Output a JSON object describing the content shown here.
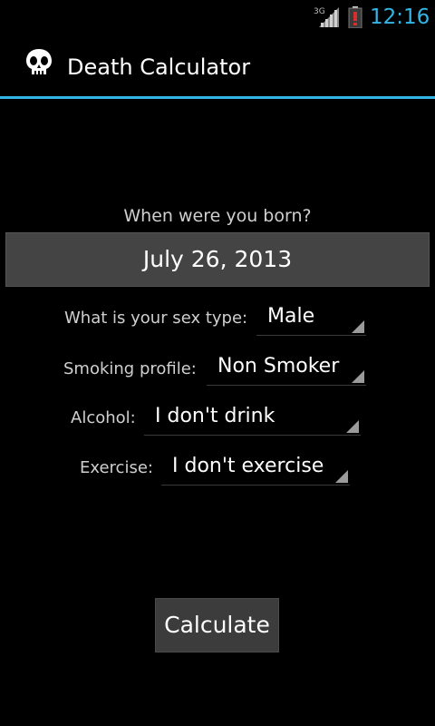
{
  "status_bar": {
    "network": "3G",
    "time": "12:16"
  },
  "action_bar": {
    "title": "Death Calculator",
    "icon": "skull-icon"
  },
  "form": {
    "birth_question": "When were you born?",
    "birth_date": "July 26, 2013",
    "sex": {
      "label": "What is your sex type:",
      "value": "Male"
    },
    "smoking": {
      "label": "Smoking profile:",
      "value": "Non Smoker"
    },
    "alcohol": {
      "label": "Alcohol:",
      "value": "I don't drink"
    },
    "exercise": {
      "label": "Exercise:",
      "value": "I don't exercise"
    },
    "calculate_label": "Calculate"
  },
  "colors": {
    "accent": "#33b5e5",
    "battery_alert": "#d32f2f",
    "background": "#000000"
  }
}
